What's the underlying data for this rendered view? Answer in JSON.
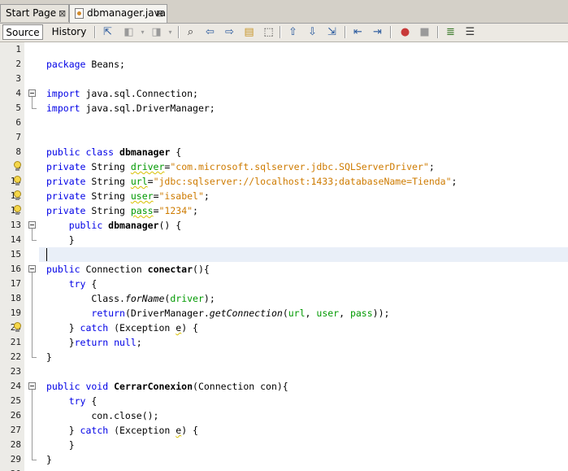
{
  "tabs": [
    {
      "label": "Start Page",
      "active": false
    },
    {
      "label": "dbmanager.java",
      "active": true
    }
  ],
  "close_glyph": "⊠",
  "view_buttons": {
    "source": "Source",
    "history": "History"
  },
  "toolbar_icons": [
    "last-edit-icon",
    "back-icon",
    "forward-icon",
    "find-icon",
    "find-previous-icon",
    "find-next-icon",
    "find-selection-icon",
    "toggle-highlight-icon",
    "previous-bookmark-icon",
    "next-bookmark-icon",
    "toggle-bookmark-icon",
    "shift-left-icon",
    "shift-right-icon",
    "start-macro-icon",
    "stop-macro-icon",
    "comment-icon",
    "uncomment-icon"
  ],
  "editor": {
    "current_line": 15,
    "lines": [
      {
        "n": "1",
        "tokens": []
      },
      {
        "n": "2",
        "tokens": [
          {
            "t": "package ",
            "c": "kw"
          },
          {
            "t": "Beans;"
          }
        ]
      },
      {
        "n": "3",
        "tokens": []
      },
      {
        "n": "4",
        "tokens": [
          {
            "t": "import ",
            "c": "kw"
          },
          {
            "t": "java.sql.Connection;"
          }
        ]
      },
      {
        "n": "5",
        "tokens": [
          {
            "t": "import ",
            "c": "kw"
          },
          {
            "t": "java.sql.DriverManager;"
          }
        ]
      },
      {
        "n": "6",
        "tokens": []
      },
      {
        "n": "7",
        "tokens": []
      },
      {
        "n": "8",
        "tokens": [
          {
            "t": "public class ",
            "c": "kw"
          },
          {
            "t": "dbmanager",
            "c": "b"
          },
          {
            "t": " {"
          }
        ]
      },
      {
        "n": "9",
        "tokens": [
          {
            "t": "private ",
            "c": "kw"
          },
          {
            "t": "String "
          },
          {
            "t": "driver",
            "c": "fld sq"
          },
          {
            "t": "="
          },
          {
            "t": "\"com.microsoft.sqlserver.jdbc.SQLServerDriver\"",
            "c": "str"
          },
          {
            "t": ";"
          }
        ]
      },
      {
        "n": "10",
        "tokens": [
          {
            "t": "private ",
            "c": "kw"
          },
          {
            "t": "String "
          },
          {
            "t": "url",
            "c": "fld sq"
          },
          {
            "t": "="
          },
          {
            "t": "\"jdbc:sqlserver://localhost:1433;databaseName=Tienda\"",
            "c": "str"
          },
          {
            "t": ";"
          }
        ]
      },
      {
        "n": "11",
        "tokens": [
          {
            "t": "private ",
            "c": "kw"
          },
          {
            "t": "String "
          },
          {
            "t": "user",
            "c": "fld sq"
          },
          {
            "t": "="
          },
          {
            "t": "\"isabel\"",
            "c": "str"
          },
          {
            "t": ";"
          }
        ]
      },
      {
        "n": "12",
        "tokens": [
          {
            "t": "private ",
            "c": "kw"
          },
          {
            "t": "String "
          },
          {
            "t": "pass",
            "c": "fld sq"
          },
          {
            "t": "="
          },
          {
            "t": "\"1234\"",
            "c": "str"
          },
          {
            "t": ";"
          }
        ]
      },
      {
        "n": "13",
        "tokens": [
          {
            "t": "    "
          },
          {
            "t": "public ",
            "c": "kw"
          },
          {
            "t": "dbmanager",
            "c": "b"
          },
          {
            "t": "() {"
          }
        ]
      },
      {
        "n": "14",
        "tokens": [
          {
            "t": "    }"
          }
        ]
      },
      {
        "n": "15",
        "tokens": []
      },
      {
        "n": "16",
        "tokens": [
          {
            "t": "public ",
            "c": "kw"
          },
          {
            "t": "Connection "
          },
          {
            "t": "conectar",
            "c": "b"
          },
          {
            "t": "(){"
          }
        ]
      },
      {
        "n": "17",
        "tokens": [
          {
            "t": "    "
          },
          {
            "t": "try",
            "c": "kw"
          },
          {
            "t": " {"
          }
        ]
      },
      {
        "n": "18",
        "tokens": [
          {
            "t": "        Class."
          },
          {
            "t": "forName",
            "c": "it"
          },
          {
            "t": "("
          },
          {
            "t": "driver",
            "c": "fld"
          },
          {
            "t": ");"
          }
        ]
      },
      {
        "n": "19",
        "tokens": [
          {
            "t": "        "
          },
          {
            "t": "return",
            "c": "kw"
          },
          {
            "t": "(DriverManager."
          },
          {
            "t": "getConnection",
            "c": "it"
          },
          {
            "t": "("
          },
          {
            "t": "url",
            "c": "fld"
          },
          {
            "t": ", "
          },
          {
            "t": "user",
            "c": "fld"
          },
          {
            "t": ", "
          },
          {
            "t": "pass",
            "c": "fld"
          },
          {
            "t": "));"
          }
        ]
      },
      {
        "n": "20",
        "tokens": [
          {
            "t": "    } "
          },
          {
            "t": "catch",
            "c": "kw"
          },
          {
            "t": " (Exception "
          },
          {
            "t": "e",
            "c": "sq"
          },
          {
            "t": ") {"
          }
        ]
      },
      {
        "n": "21",
        "tokens": [
          {
            "t": "    }"
          },
          {
            "t": "return null",
            "c": "kw"
          },
          {
            "t": ";"
          }
        ]
      },
      {
        "n": "22",
        "tokens": [
          {
            "t": "}"
          }
        ]
      },
      {
        "n": "23",
        "tokens": []
      },
      {
        "n": "24",
        "tokens": [
          {
            "t": "public void ",
            "c": "kw"
          },
          {
            "t": "CerrarConexion",
            "c": "b"
          },
          {
            "t": "(Connection con){"
          }
        ]
      },
      {
        "n": "25",
        "tokens": [
          {
            "t": "    "
          },
          {
            "t": "try",
            "c": "kw"
          },
          {
            "t": " {"
          }
        ]
      },
      {
        "n": "26",
        "tokens": [
          {
            "t": "        con.close();"
          }
        ]
      },
      {
        "n": "27",
        "tokens": [
          {
            "t": "    } "
          },
          {
            "t": "catch",
            "c": "kw"
          },
          {
            "t": " (Exception "
          },
          {
            "t": "e",
            "c": "sq"
          },
          {
            "t": ") {"
          }
        ]
      },
      {
        "n": "28",
        "tokens": [
          {
            "t": "    }"
          }
        ]
      },
      {
        "n": "29",
        "tokens": [
          {
            "t": "}"
          }
        ]
      },
      {
        "n": "30",
        "tokens": []
      }
    ],
    "fold_markers": [
      4,
      13,
      16,
      24
    ],
    "hint_lines": [
      9,
      10,
      11,
      12,
      20
    ]
  }
}
